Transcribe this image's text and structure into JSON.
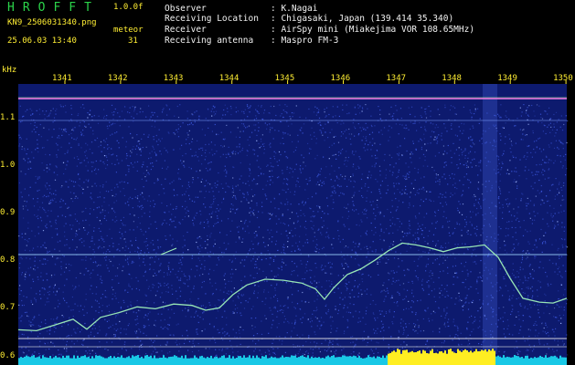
{
  "header": {
    "brand": "HROFFT",
    "version": "1.0.0f",
    "filename": "KN9_2506031340.png",
    "meteor_label": "meteor",
    "datetime": "25.06.03 13:40",
    "meteor_count": "31",
    "observer_label": "Observer",
    "observer_value": ": K.Nagai",
    "location_label": "Receiving Location",
    "location_value": ": Chigasaki, Japan (139.414 35.340)",
    "receiver_label": "Receiver",
    "receiver_value": ": AirSpy mini (Miakejima VOR 108.65MHz)",
    "antenna_label": "Receiving antenna",
    "antenna_value": ": Maspro FM-3"
  },
  "chart_data": {
    "type": "heatmap",
    "ylabel": "kHz",
    "x_ticks": [
      "1341",
      "1342",
      "1343",
      "1344",
      "1345",
      "1346",
      "1347",
      "1348",
      "1349",
      "1350"
    ],
    "y_ticks": [
      "1.1",
      "1.0",
      "0.9",
      "0.8",
      "0.7",
      "0.6"
    ],
    "ylim": [
      0.58,
      1.17
    ],
    "colors": {
      "background": "#0d1a6e",
      "noise": "#3a55d8",
      "trace": "#9ff0b8",
      "carrier": "#e07ad8",
      "ticks": "#ffee33",
      "bottom_bar": "#19c8e6",
      "bottom_bar_peak": "#ffee22"
    }
  }
}
